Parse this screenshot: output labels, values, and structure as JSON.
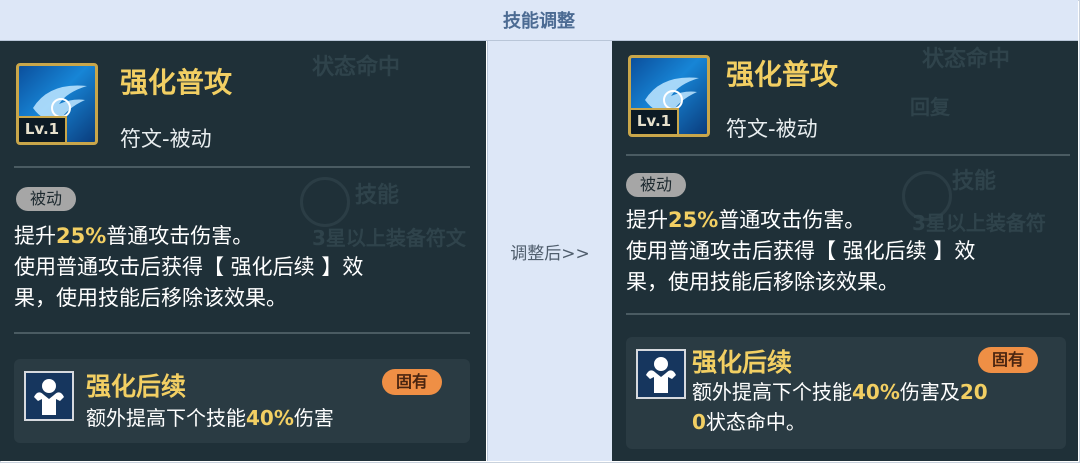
{
  "header": {
    "title": "技能调整"
  },
  "middle": {
    "label": "调整后>>"
  },
  "background_labels": {
    "left": [
      "状态命中",
      "技能",
      "3星以上装备符文"
    ],
    "right": [
      "状态命中",
      "回复",
      "技能",
      "3星以上装备符",
      "被动"
    ]
  },
  "before": {
    "skill_name": "强化普攻",
    "level": "Lv.1",
    "skill_type": "符文-被动",
    "tag": "被动",
    "desc_line1_pre": "提升",
    "desc_line1_hl": "25%",
    "desc_line1_post": "普通攻击伤害。",
    "desc_line2": "使用普通攻击后获得【 强化后续 】效",
    "desc_line3": "果，使用技能后移除该效果。",
    "sub": {
      "name": "强化后续",
      "badge": "固有",
      "desc_pre": "额外提高下个技能",
      "desc_hl": "40%",
      "desc_post": "伤害"
    }
  },
  "after": {
    "skill_name": "强化普攻",
    "level": "Lv.1",
    "skill_type": "符文-被动",
    "tag": "被动",
    "desc_line1_pre": "提升",
    "desc_line1_hl": "25%",
    "desc_line1_post": "普通攻击伤害。",
    "desc_line2": "使用普通攻击后获得【 强化后续 】效",
    "desc_line3": "果，使用技能后移除该效果。",
    "sub": {
      "name": "强化后续",
      "badge": "固有",
      "desc_line1_pre": "额外提高下个技能",
      "desc_line1_hl": "40%",
      "desc_line1_mid": "伤害及",
      "desc_line1_hl2": "20",
      "desc_line2_hl": "0",
      "desc_line2_post": "状态命中。"
    }
  },
  "colors": {
    "gold": "#f2cf63",
    "panel": "#1f3038",
    "header_bg": "#dde7f7",
    "badge": "#ef8f45"
  }
}
